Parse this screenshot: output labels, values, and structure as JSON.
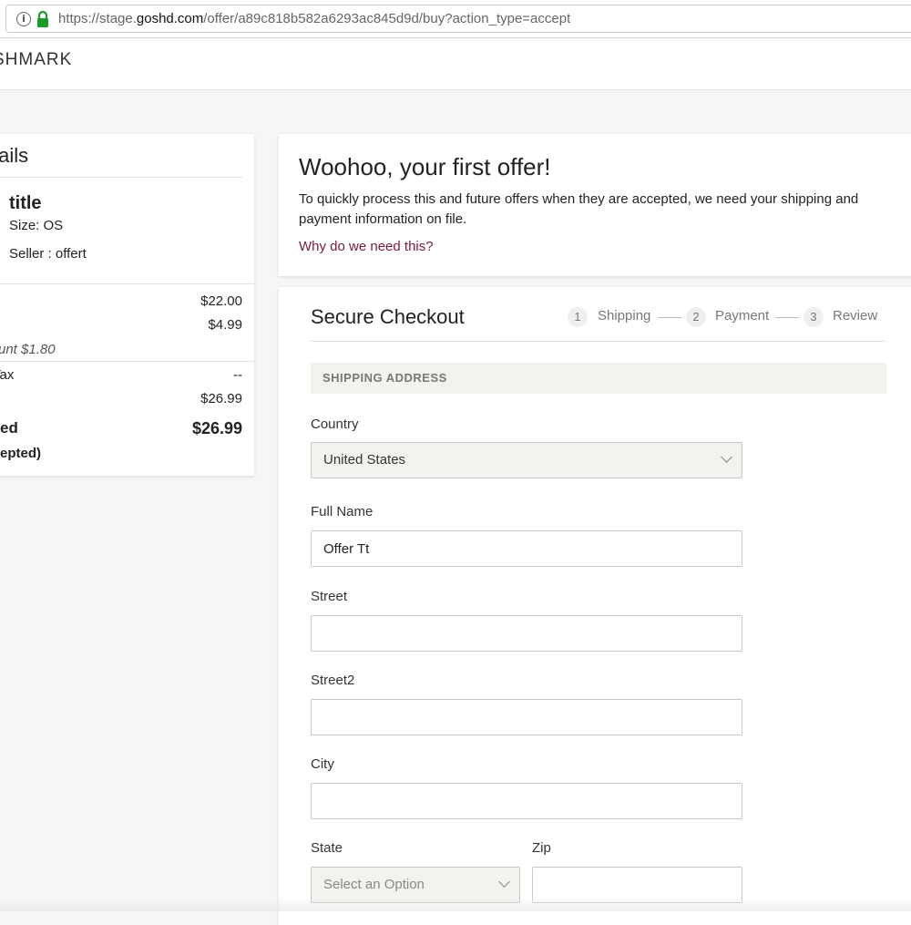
{
  "browser": {
    "url_prefix": "https://stage.",
    "url_host": "goshd.com",
    "url_path": "/offer/a89c818b582a6293ac845d9d/buy?action_type=accept"
  },
  "header": {
    "brand": "SHMARK"
  },
  "order_details": {
    "title": "tails",
    "item_title": "title",
    "item_size": "Size: OS",
    "item_seller": "Seller : offert",
    "price": "$22.00",
    "shipping": "$4.99",
    "discount": "unt $1.80",
    "tax_label": "Tax",
    "tax_value": "--",
    "subtotal": "$26.99",
    "total_label": "ed",
    "total_value": "$26.99",
    "total_note": "epted)"
  },
  "offer": {
    "title": "Woohoo, your first offer!",
    "text": "To quickly process this and future offers when they are accepted, we need your shipping and payment information on file.",
    "link": "Why do we need this?"
  },
  "checkout": {
    "title": "Secure Checkout",
    "steps": [
      {
        "num": "1",
        "label": "Shipping"
      },
      {
        "num": "2",
        "label": "Payment"
      },
      {
        "num": "3",
        "label": "Review"
      }
    ],
    "section_title": "SHIPPING ADDRESS",
    "country_label": "Country",
    "country_value": "United States",
    "full_name_label": "Full Name",
    "full_name_value": "Offer Tt",
    "street_label": "Street",
    "street_value": "",
    "street2_label": "Street2",
    "street2_value": "",
    "city_label": "City",
    "city_value": "",
    "state_label": "State",
    "state_placeholder": "Select an Option",
    "zip_label": "Zip",
    "zip_value": ""
  }
}
